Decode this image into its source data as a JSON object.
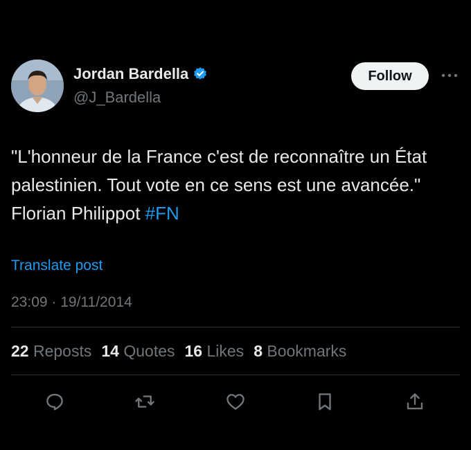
{
  "author": {
    "display_name": "Jordan Bardella",
    "handle": "@J_Bardella",
    "verified": true
  },
  "follow_label": "Follow",
  "tweet": {
    "text_before_hashtag": "\"L'honneur de la France c'est de reconnaître un État palestinien. Tout vote en ce sens est une avancée.\" Florian Philippot ",
    "hashtag": "#FN"
  },
  "translate_label": "Translate post",
  "timestamp": "23:09 · 19/11/2014",
  "stats": [
    {
      "count": "22",
      "label": "Reposts"
    },
    {
      "count": "14",
      "label": "Quotes"
    },
    {
      "count": "16",
      "label": "Likes"
    },
    {
      "count": "8",
      "label": "Bookmarks"
    }
  ],
  "actions": [
    "reply-icon",
    "repost-icon",
    "like-icon",
    "bookmark-icon",
    "share-icon"
  ],
  "colors": {
    "background": "#000000",
    "text": "#e7e9ea",
    "muted": "#71767b",
    "accent": "#1d9bf0",
    "follow_bg": "#eff3f4"
  }
}
